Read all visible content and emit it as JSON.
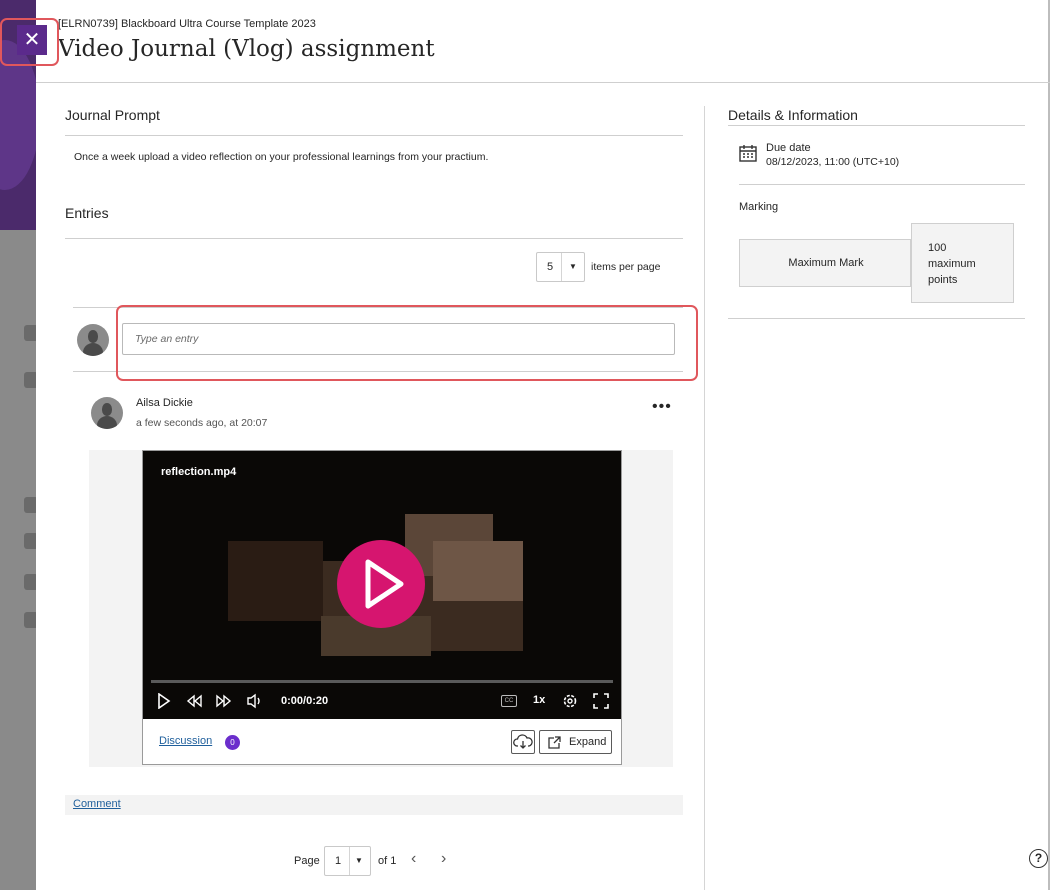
{
  "header": {
    "course_name": "[ELRN0739] Blackboard Ultra Course Template 2023",
    "title": "Video Journal (Vlog) assignment",
    "close_symbol": "✕"
  },
  "journal_prompt": {
    "heading": "Journal Prompt",
    "text": "Once a week upload a video reflection on your professional learnings from your practium."
  },
  "entries": {
    "heading": "Entries",
    "items_per_page_value": "5",
    "items_per_page_label": "items per page",
    "new_entry_placeholder": "Type an entry"
  },
  "entry": {
    "author": "Ailsa Dickie",
    "timestamp": "a few seconds ago, at 20:07",
    "more_symbol": "•••",
    "video": {
      "file_name": "reflection.mp4",
      "time": "0:00/0:20",
      "cc_label": "CC",
      "speed": "1x",
      "progress": 0
    },
    "discussion_label": "Discussion",
    "discussion_count": "0",
    "expand_label": "Expand",
    "comment_label": "Comment"
  },
  "pagination": {
    "page_label": "Page",
    "page_value": "1",
    "of_label": "of 1",
    "prev_symbol": "‹",
    "next_symbol": "›"
  },
  "details": {
    "heading": "Details & Information",
    "due_label": "Due date",
    "due_value": "08/12/2023, 11:00 (UTC+10)",
    "marking_label": "Marking",
    "max_mark_label": "Maximum Mark",
    "max_points": "100 maximum points"
  },
  "help_symbol": "?",
  "colors": {
    "accent_purple": "#5b2a8c",
    "play_pink": "#d6156f",
    "link_blue": "#1f5f9c",
    "highlight_red": "#e0575c",
    "badge_purple": "#6b2ecc"
  }
}
